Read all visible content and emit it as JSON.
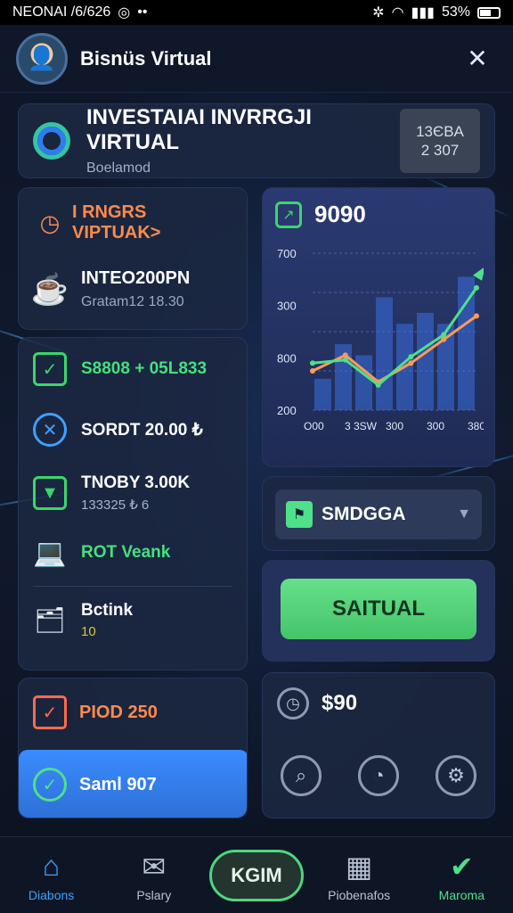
{
  "status_bar": {
    "left_text": "NEONAI /6/626",
    "battery": "53%"
  },
  "header": {
    "title": "Bisnüs Virtual",
    "avatar_icon": "avatar-icon",
    "tools_icon": "tools-icon"
  },
  "hero": {
    "title": "INVESTAIAI INVRRGJI VIRTUAL",
    "subtitle": "Boelamod",
    "badge_line1": "13ЄBA",
    "badge_line2": "2 307"
  },
  "left_card_1": {
    "heading": "I RNGRS VIPTUAK>",
    "item_main": "INTEO200PN",
    "item_sub": "Gratam12 18.30"
  },
  "left_card_2": {
    "items": [
      {
        "main": "S8808 + 05L833",
        "sub": ""
      },
      {
        "main": "SORDT 20.00 ₺",
        "sub": ""
      },
      {
        "main": "TNOBY 3.00K",
        "sub": "133325 ₺ 6"
      },
      {
        "main": "ROT Veank",
        "sub": ""
      },
      {
        "main": "Bctink",
        "sub": "10"
      }
    ]
  },
  "left_card_3": {
    "row1": "PIOD 250",
    "row2": "Saml 907"
  },
  "chart_card": {
    "value": "9090",
    "colors": {
      "line_green": "#4fe08a",
      "line_orange": "#ff9a55",
      "bar": "#3b6fe0"
    }
  },
  "chart_data": {
    "type": "bar",
    "title": "",
    "xlabel": "",
    "ylabel": "",
    "y_tick_labels": [
      "700",
      "300",
      "800",
      "200"
    ],
    "x_tick_labels": [
      "O00",
      "3 3SW",
      "300",
      "300",
      "3800"
    ],
    "bar_values": [
      0.2,
      0.42,
      0.35,
      0.72,
      0.55,
      0.62,
      0.55,
      0.85
    ],
    "series": [
      {
        "values": [
          0.25,
          0.35,
          0.18,
          0.3,
          0.45,
          0.6
        ]
      },
      {
        "values": [
          0.3,
          0.32,
          0.16,
          0.34,
          0.48,
          0.78
        ]
      }
    ]
  },
  "select": {
    "value": "SMDGGA"
  },
  "action": {
    "button_label": "SAITUAL"
  },
  "bottom_card": {
    "value": "$90"
  },
  "bottom_nav": {
    "items": [
      {
        "label": "Diabons",
        "icon": "home-icon"
      },
      {
        "label": "Pslary",
        "icon": "mail-icon"
      },
      {
        "label": "KGIM",
        "icon": ""
      },
      {
        "label": "Piobenafos",
        "icon": "calculator-icon"
      },
      {
        "label": "Maroma",
        "icon": "check-circle-icon"
      }
    ]
  }
}
